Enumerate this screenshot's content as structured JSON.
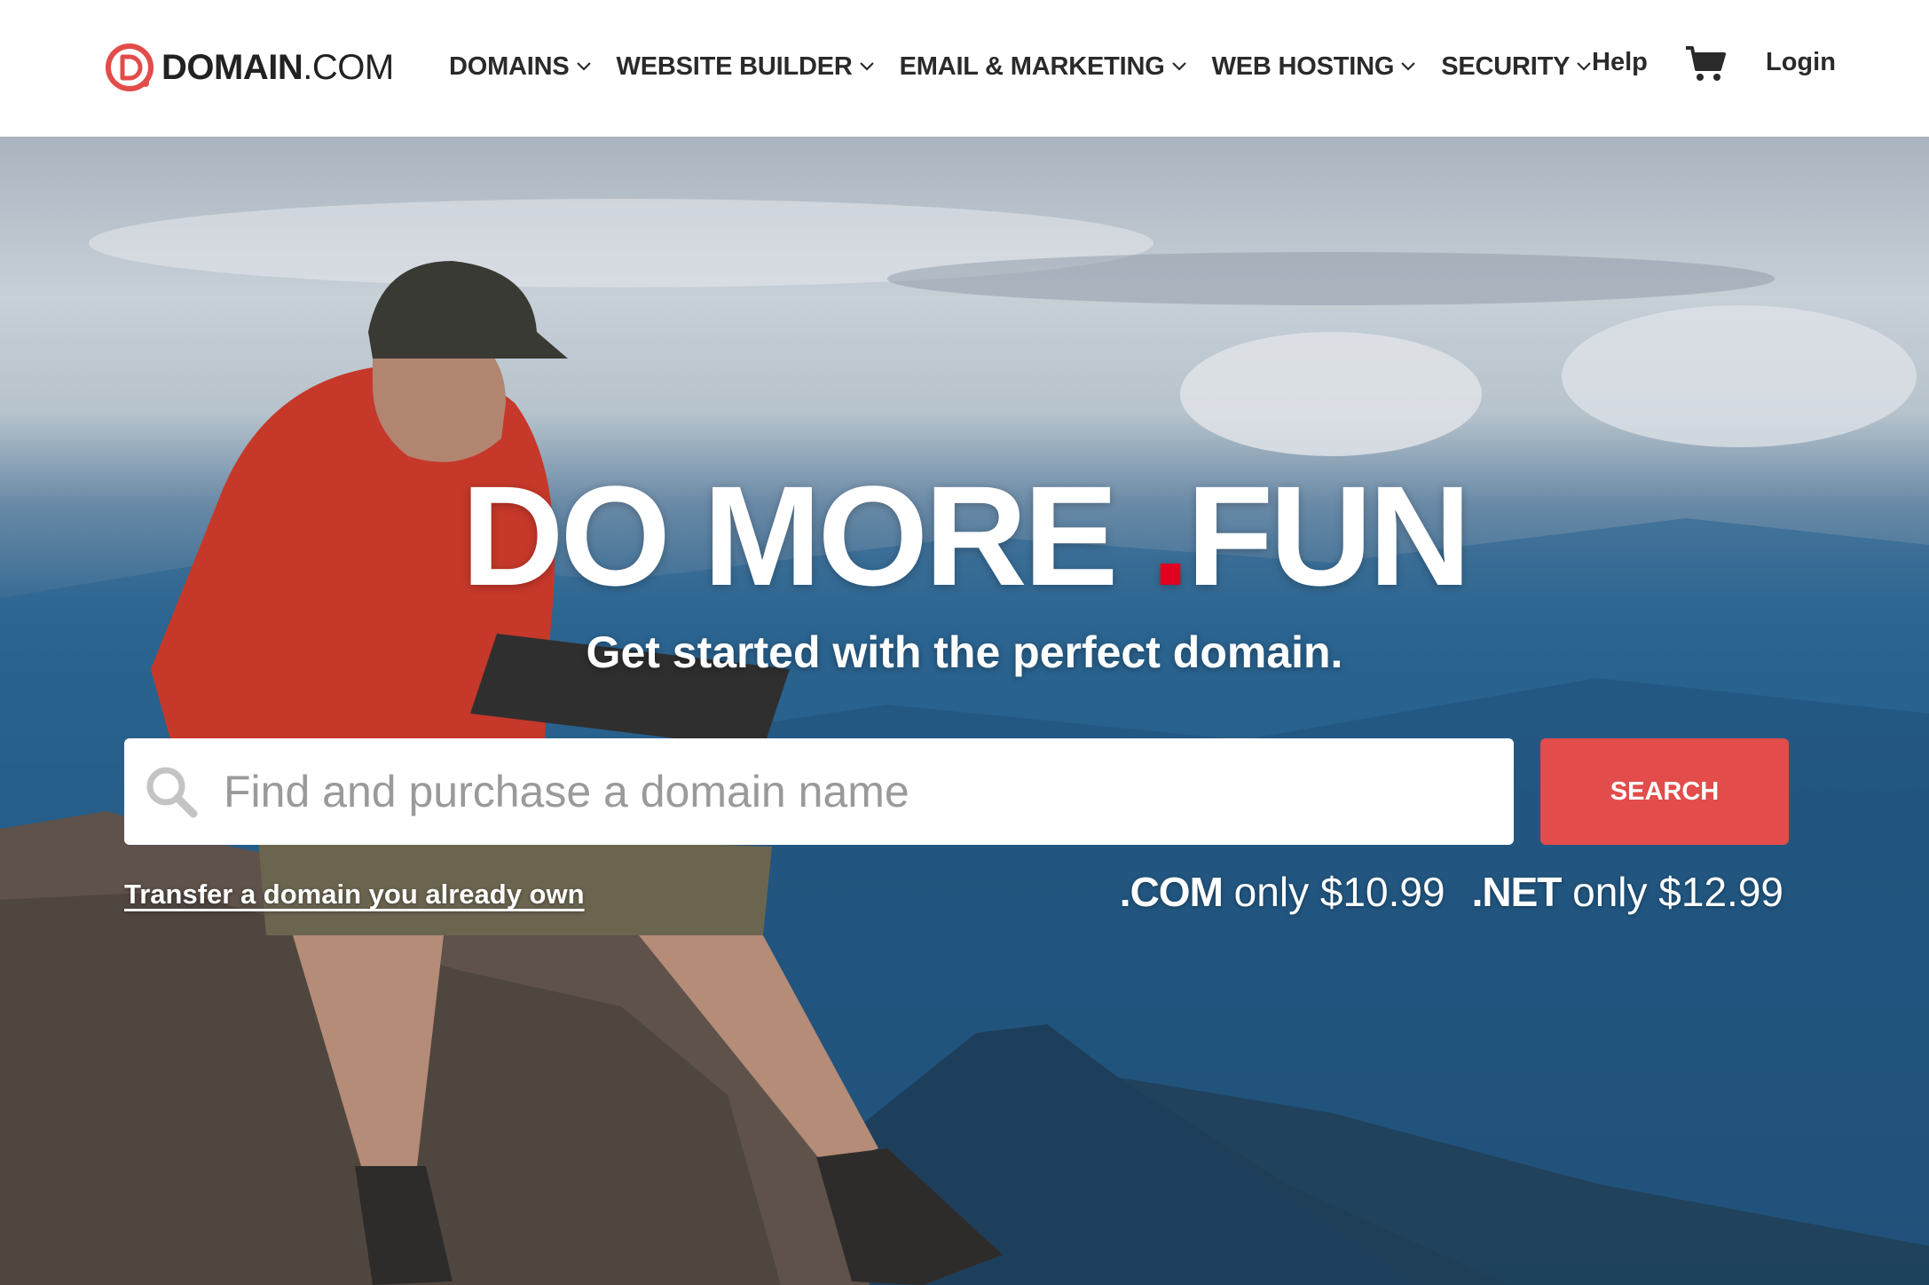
{
  "header": {
    "logo": {
      "strong": "DOMAIN",
      "light": ".COM"
    },
    "nav": [
      {
        "label": "DOMAINS",
        "icon": "chevron-down-icon"
      },
      {
        "label": "WEBSITE BUILDER",
        "icon": "chevron-down-icon"
      },
      {
        "label": "EMAIL & MARKETING",
        "icon": "chevron-down-icon"
      },
      {
        "label": "WEB HOSTING",
        "icon": "chevron-down-icon"
      },
      {
        "label": "SECURITY",
        "icon": "chevron-down-icon"
      }
    ],
    "help_label": "Help",
    "cart_icon": "cart-icon",
    "login_label": "Login"
  },
  "hero": {
    "headline_part1": "DO MORE ",
    "headline_dot": ".",
    "headline_part2": "FUN",
    "subheadline": "Get started with the perfect domain.",
    "search": {
      "icon": "search-icon",
      "placeholder": "Find and purchase a domain name",
      "value": "",
      "button_label": "SEARCH"
    },
    "transfer_link": "Transfer a domain you already own",
    "prices": [
      {
        "tld": ".COM",
        "text": " only $10.99"
      },
      {
        "tld": ".NET",
        "text": " only $12.99"
      }
    ]
  },
  "colors": {
    "accent_red": "#e24c4a",
    "dot_red": "#e1001f",
    "text_dark": "#2a2a2a",
    "white": "#ffffff"
  }
}
